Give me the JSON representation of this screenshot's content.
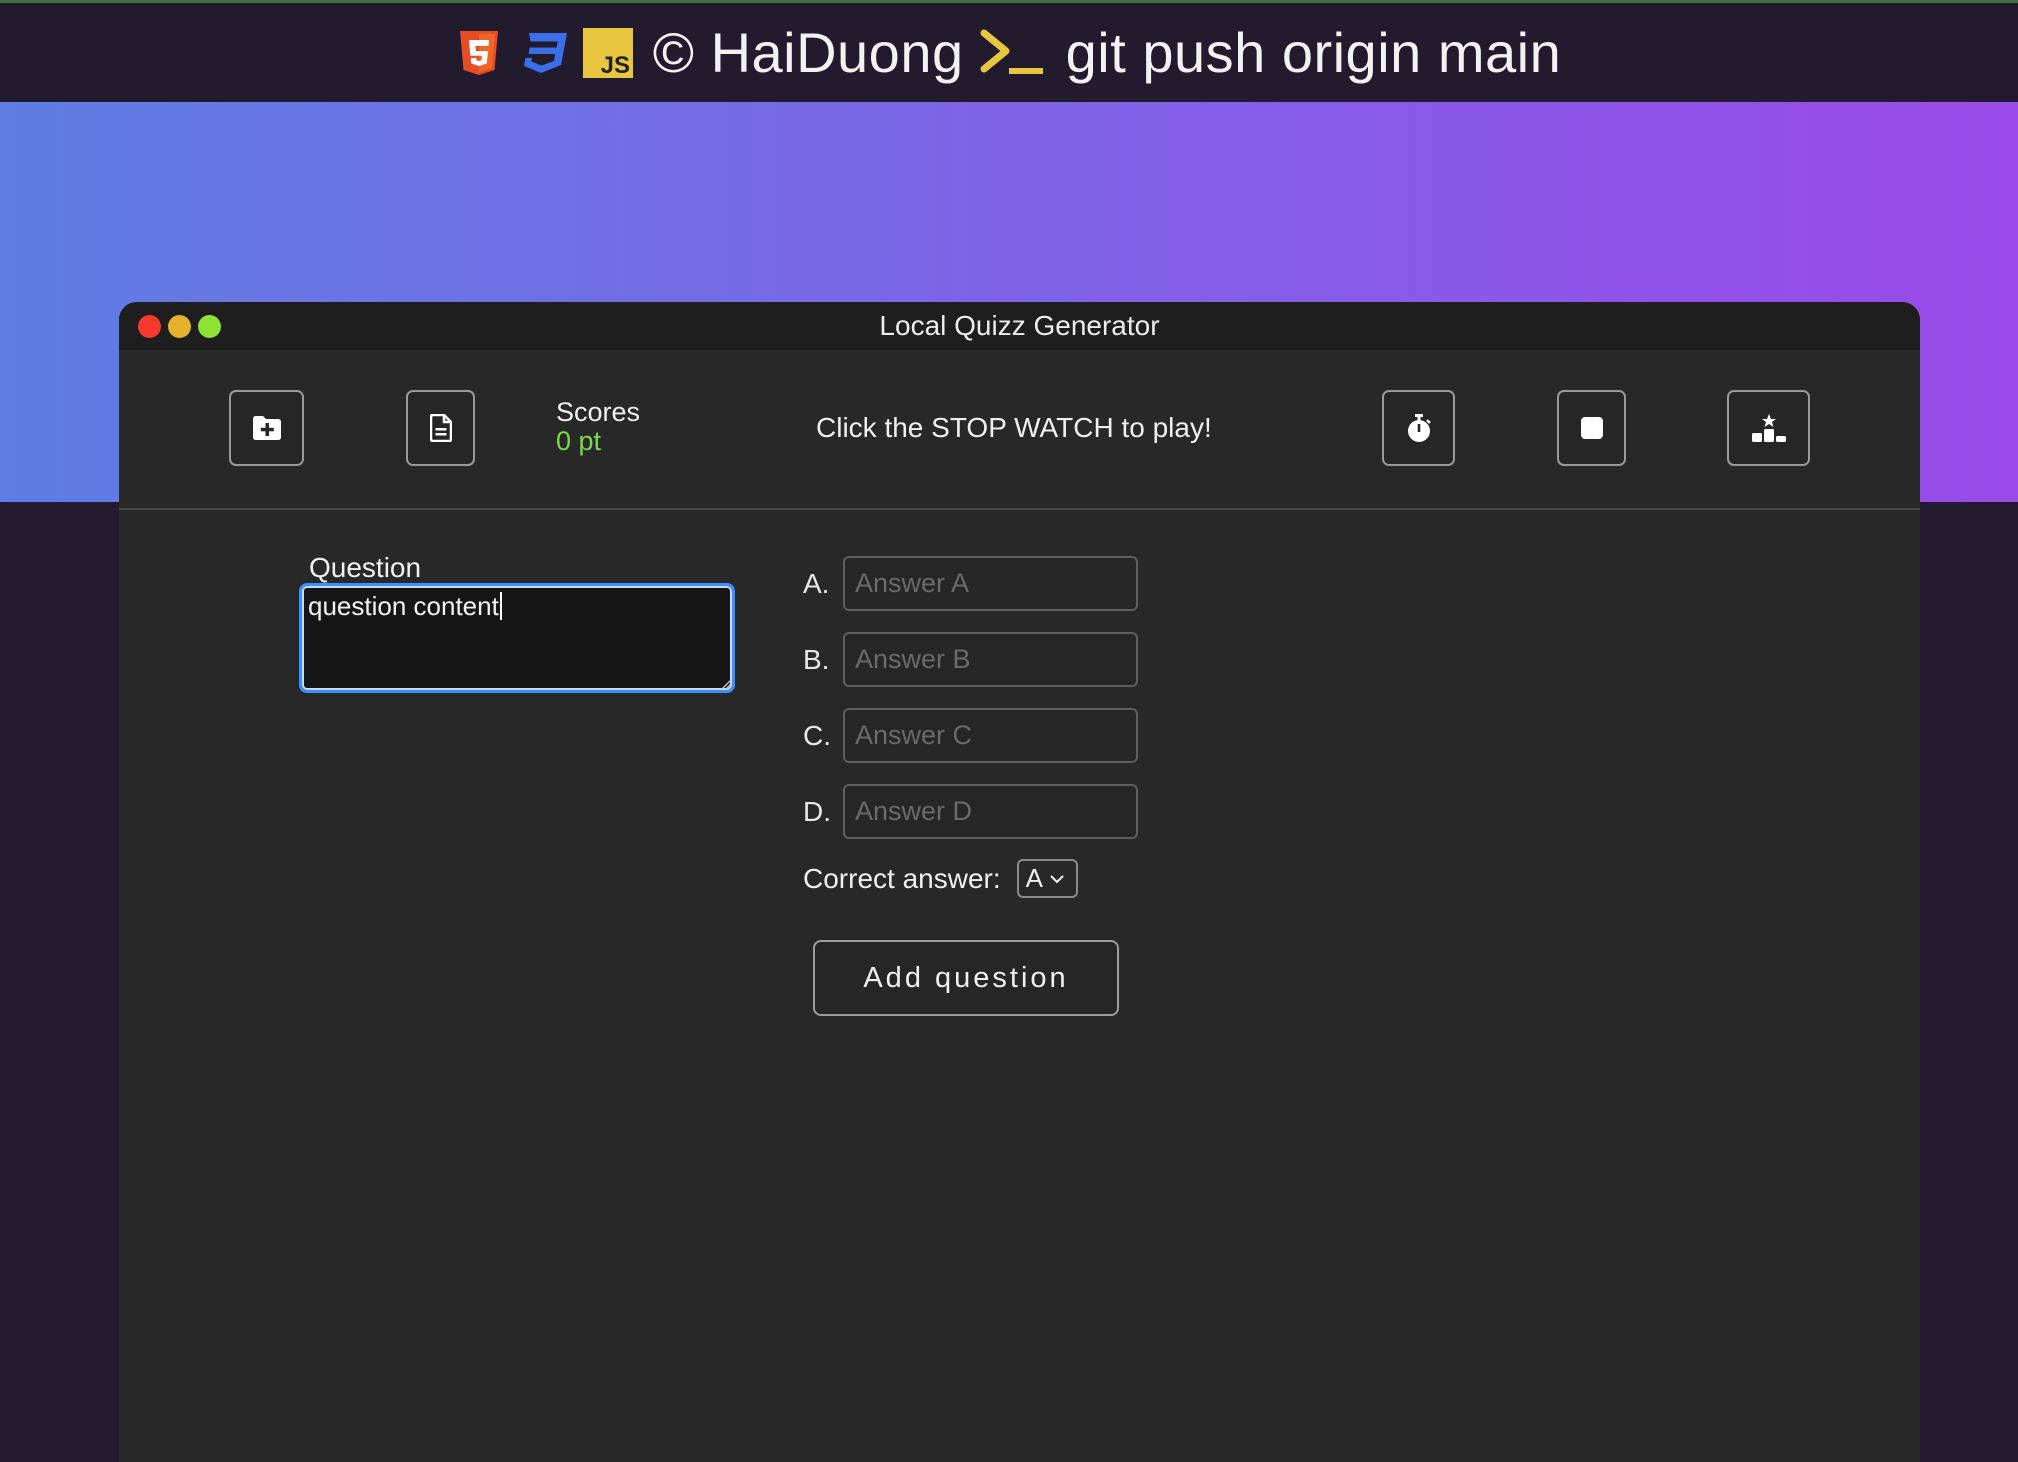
{
  "header": {
    "credit": "© HaiDuong",
    "command": "git push origin main",
    "badges": [
      "html5-icon",
      "css3-icon",
      "javascript-icon",
      "terminal-icon"
    ]
  },
  "window": {
    "title": "Local Quizz Generator"
  },
  "toolbar": {
    "new_folder_icon": "folder-plus-icon",
    "file_icon": "file-text-icon",
    "scores_label": "Scores",
    "scores_value": "0 pt",
    "hint": "Click the STOP WATCH to play!",
    "stopwatch_icon": "stopwatch-icon",
    "stop_icon": "stop-icon",
    "leaderboard_icon": "podium-icon"
  },
  "form": {
    "question_label": "Question",
    "question_value": "question content",
    "answers": [
      {
        "letter": "A.",
        "placeholder": "Answer A"
      },
      {
        "letter": "B.",
        "placeholder": "Answer B"
      },
      {
        "letter": "C.",
        "placeholder": "Answer C"
      },
      {
        "letter": "D.",
        "placeholder": "Answer D"
      }
    ],
    "correct_label": "Correct answer:",
    "correct_value": "A",
    "add_button": "Add question"
  },
  "colors": {
    "accent_green": "#7dd84a",
    "focus_blue": "#3b8fff",
    "gradient_start": "#5f7de3",
    "gradient_end": "#9a4ae8"
  }
}
